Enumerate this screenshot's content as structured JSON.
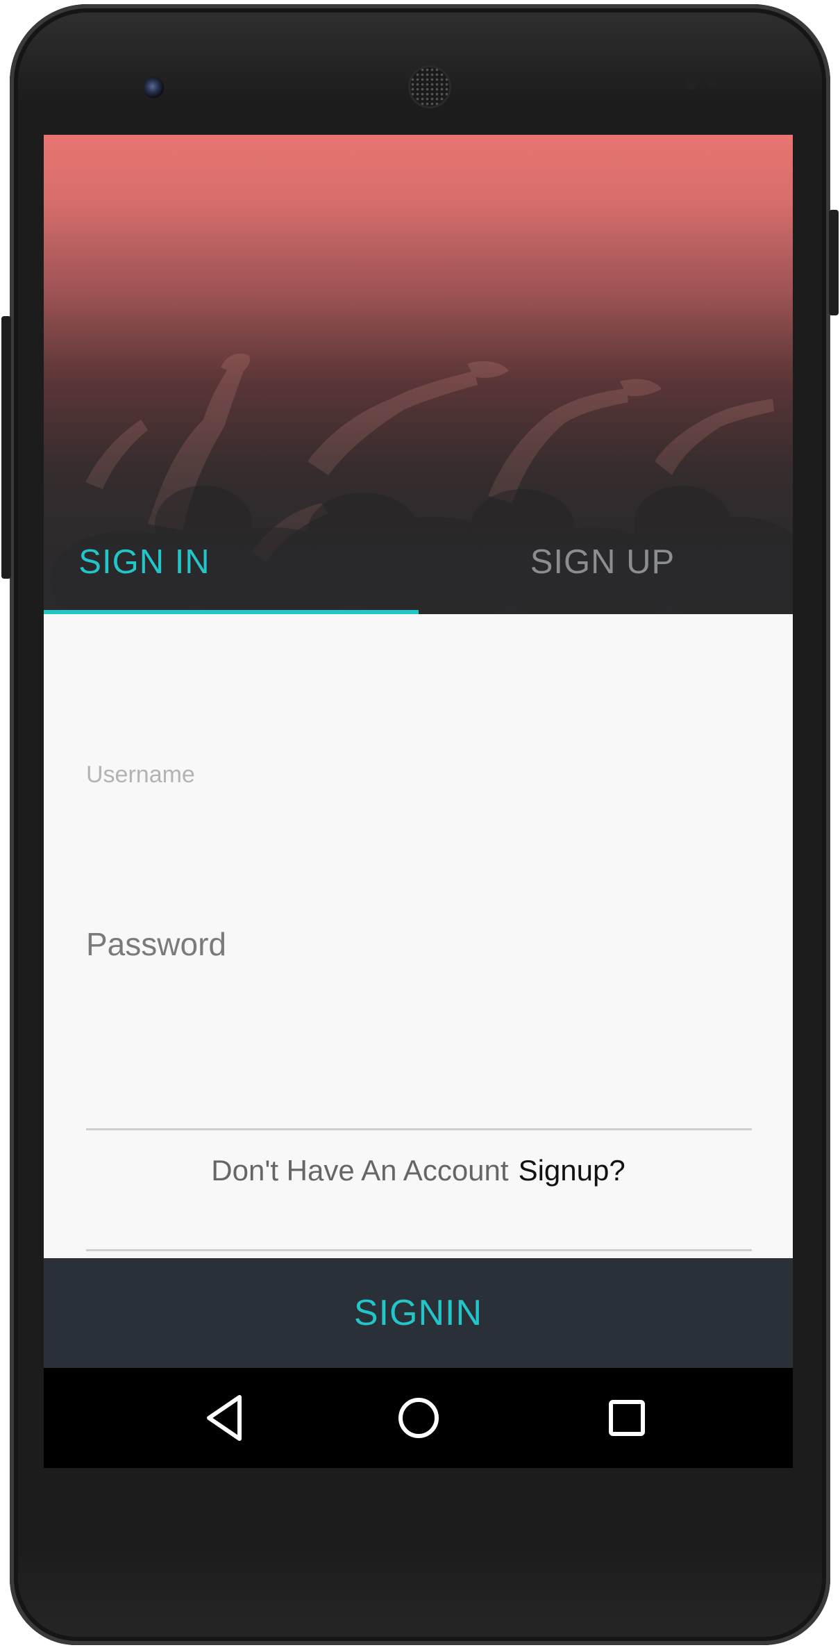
{
  "tabs": {
    "sign_in": "SIGN IN",
    "sign_up": "SIGN UP",
    "active": "sign_in"
  },
  "form": {
    "username_label": "Username",
    "username_value": "",
    "password_placeholder": "Password",
    "account_prompt": "Don't Have An Account",
    "signup_link": "Signup?"
  },
  "actions": {
    "signin_label": "SIGNIN"
  },
  "navigation": {
    "icons": [
      "back-icon",
      "home-icon",
      "recents-icon"
    ]
  },
  "colors": {
    "accent": "#22c5c8",
    "action_bar": "#2a3038",
    "hero_top": "#e87571",
    "background": "#f8f8f8"
  }
}
